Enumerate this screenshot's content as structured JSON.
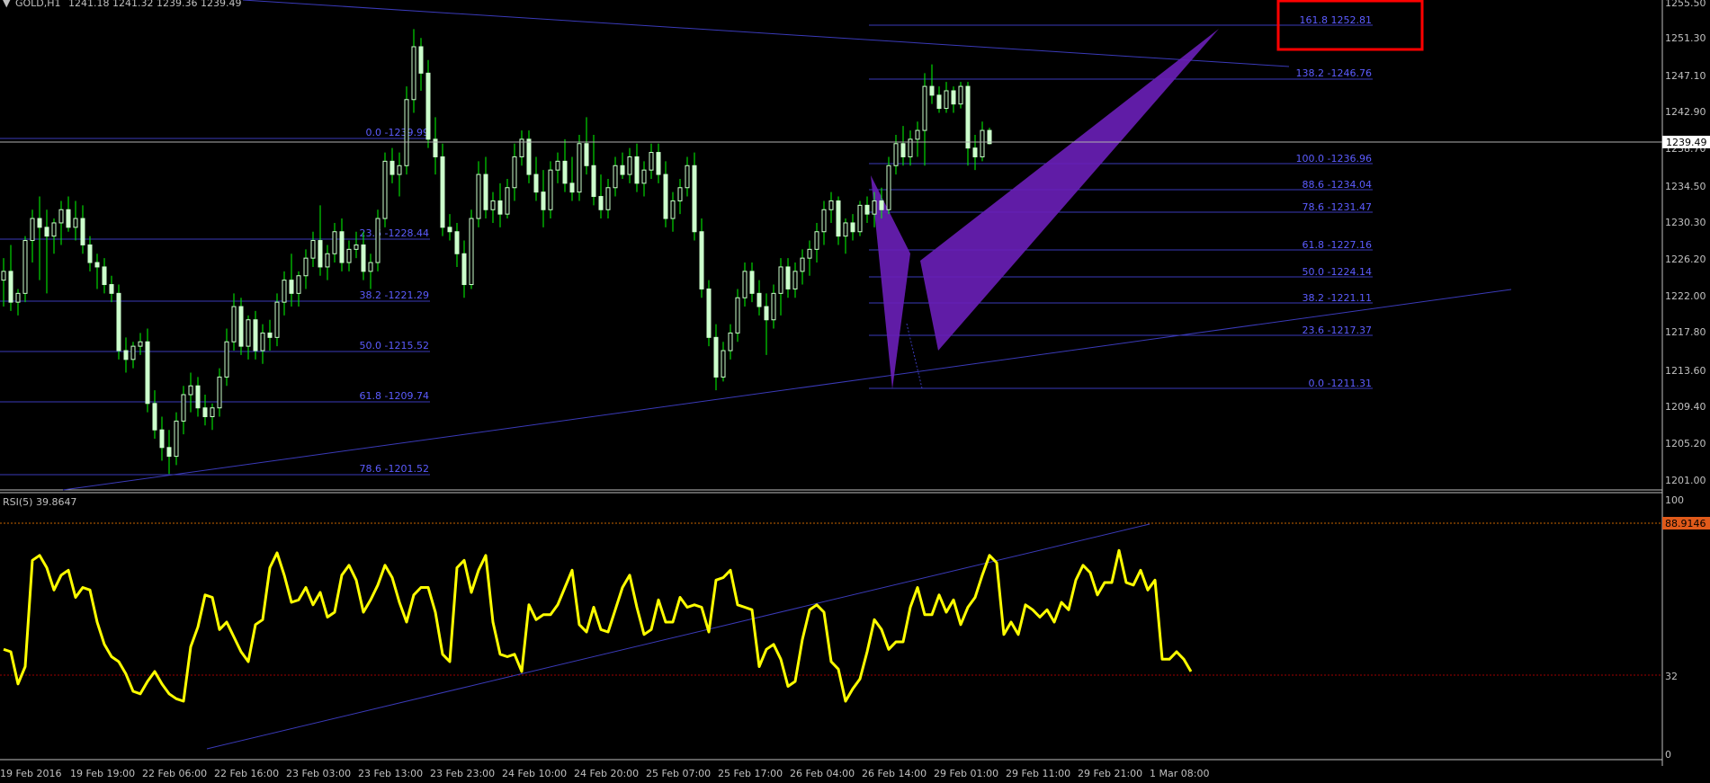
{
  "header": {
    "collapse_glyph": "▼",
    "symbol_label": "GOLD,H1",
    "ohlc_text": "1241.18 1241.32 1239.36 1239.49"
  },
  "price_axis": {
    "labels": [
      "1255.50",
      "1251.30",
      "1247.10",
      "1242.90",
      "1238.70",
      "1234.50",
      "1230.30",
      "1226.20",
      "1222.00",
      "1217.80",
      "1213.60",
      "1209.40",
      "1205.20",
      "1201.00"
    ],
    "current_price": "1239.49"
  },
  "rsi": {
    "label": "RSI(5) 39.8647",
    "axis_labels": [
      "100",
      "32",
      "0"
    ],
    "badge_value": "88.9146"
  },
  "time_axis": {
    "labels": [
      "19 Feb 2016",
      "19 Feb 19:00",
      "22 Feb 06:00",
      "22 Feb 16:00",
      "23 Feb 03:00",
      "23 Feb 13:00",
      "23 Feb 23:00",
      "24 Feb 10:00",
      "24 Feb 20:00",
      "25 Feb 07:00",
      "25 Feb 17:00",
      "26 Feb 04:00",
      "26 Feb 14:00",
      "29 Feb 01:00",
      "29 Feb 11:00",
      "29 Feb 21:00",
      "1 Mar 08:00"
    ]
  },
  "fib_left": {
    "labels": [
      "0.0 -1239.99",
      "23.6 -1228.44",
      "38.2 -1221.29",
      "50.0 -1215.52",
      "61.8 -1209.74",
      "78.6 -1201.52"
    ]
  },
  "fib_right": {
    "labels": [
      "161.8 1252.81",
      "138.2  -1246.76",
      "100.0 -1236.96",
      "88.6 -1234.04",
      "78.6 -1231.47",
      "61.8 -1227.16",
      "50.0 -1224.14",
      "38.2 -1221.11",
      "23.6 -1217.37",
      "0.0 -1211.31"
    ]
  },
  "colors": {
    "background": "#000000",
    "candle": "#ccffcc",
    "wick": "#00ff00",
    "fib_line": "#3a3ab8",
    "fib_text": "#5c5cff",
    "pattern_fill": "#6a1fb8",
    "rsi_line": "#ffff00",
    "highlight_box": "#ff0000",
    "level_red": "#c86400",
    "axis_text": "#c0c0c0"
  },
  "chart_data": {
    "type": "candlestick",
    "symbol": "GOLD",
    "timeframe": "H1",
    "price_range": [
      1201.0,
      1255.5
    ],
    "candles": [
      {
        "o": 1224.0,
        "h": 1226.5,
        "l": 1221.0,
        "c": 1225.0
      },
      {
        "o": 1225.0,
        "h": 1228.0,
        "l": 1220.5,
        "c": 1221.5
      },
      {
        "o": 1221.5,
        "h": 1223.0,
        "l": 1220.0,
        "c": 1222.5
      },
      {
        "o": 1222.5,
        "h": 1229.0,
        "l": 1221.5,
        "c": 1228.5
      },
      {
        "o": 1228.5,
        "h": 1232.0,
        "l": 1226.0,
        "c": 1231.0
      },
      {
        "o": 1231.0,
        "h": 1233.5,
        "l": 1224.0,
        "c": 1230.0
      },
      {
        "o": 1230.0,
        "h": 1232.0,
        "l": 1222.5,
        "c": 1229.0
      },
      {
        "o": 1229.0,
        "h": 1231.0,
        "l": 1227.0,
        "c": 1230.5
      },
      {
        "o": 1230.5,
        "h": 1233.0,
        "l": 1228.0,
        "c": 1232.0
      },
      {
        "o": 1232.0,
        "h": 1233.5,
        "l": 1229.5,
        "c": 1230.0
      },
      {
        "o": 1230.0,
        "h": 1233.0,
        "l": 1228.5,
        "c": 1231.0
      },
      {
        "o": 1231.0,
        "h": 1232.5,
        "l": 1227.0,
        "c": 1228.0
      },
      {
        "o": 1228.0,
        "h": 1229.0,
        "l": 1225.0,
        "c": 1226.0
      },
      {
        "o": 1226.0,
        "h": 1227.0,
        "l": 1223.0,
        "c": 1225.5
      },
      {
        "o": 1225.5,
        "h": 1226.5,
        "l": 1222.5,
        "c": 1223.5
      },
      {
        "o": 1223.5,
        "h": 1224.5,
        "l": 1221.5,
        "c": 1222.5
      },
      {
        "o": 1222.5,
        "h": 1223.5,
        "l": 1215.0,
        "c": 1216.0
      },
      {
        "o": 1216.0,
        "h": 1217.5,
        "l": 1213.5,
        "c": 1215.0
      },
      {
        "o": 1215.0,
        "h": 1217.0,
        "l": 1214.0,
        "c": 1216.5
      },
      {
        "o": 1216.5,
        "h": 1218.0,
        "l": 1215.5,
        "c": 1217.0
      },
      {
        "o": 1217.0,
        "h": 1218.5,
        "l": 1209.0,
        "c": 1210.0
      },
      {
        "o": 1210.0,
        "h": 1211.5,
        "l": 1206.0,
        "c": 1207.0
      },
      {
        "o": 1207.0,
        "h": 1208.5,
        "l": 1203.5,
        "c": 1205.0
      },
      {
        "o": 1205.0,
        "h": 1207.0,
        "l": 1202.0,
        "c": 1204.0
      },
      {
        "o": 1204.0,
        "h": 1209.0,
        "l": 1203.0,
        "c": 1208.0
      },
      {
        "o": 1208.0,
        "h": 1212.0,
        "l": 1206.5,
        "c": 1211.0
      },
      {
        "o": 1211.0,
        "h": 1213.5,
        "l": 1209.0,
        "c": 1212.0
      },
      {
        "o": 1212.0,
        "h": 1213.0,
        "l": 1208.5,
        "c": 1209.5
      },
      {
        "o": 1209.5,
        "h": 1211.0,
        "l": 1207.5,
        "c": 1208.5
      },
      {
        "o": 1208.5,
        "h": 1210.0,
        "l": 1207.0,
        "c": 1209.5
      },
      {
        "o": 1209.5,
        "h": 1214.0,
        "l": 1208.5,
        "c": 1213.0
      },
      {
        "o": 1213.0,
        "h": 1218.5,
        "l": 1212.0,
        "c": 1217.0
      },
      {
        "o": 1217.0,
        "h": 1222.5,
        "l": 1216.0,
        "c": 1221.0
      },
      {
        "o": 1221.0,
        "h": 1222.0,
        "l": 1215.5,
        "c": 1216.5
      },
      {
        "o": 1216.5,
        "h": 1220.0,
        "l": 1215.0,
        "c": 1219.5
      },
      {
        "o": 1219.5,
        "h": 1220.5,
        "l": 1215.0,
        "c": 1216.0
      },
      {
        "o": 1216.0,
        "h": 1219.0,
        "l": 1214.5,
        "c": 1218.0
      },
      {
        "o": 1218.0,
        "h": 1219.5,
        "l": 1216.0,
        "c": 1217.5
      },
      {
        "o": 1217.5,
        "h": 1222.5,
        "l": 1216.5,
        "c": 1221.5
      },
      {
        "o": 1221.5,
        "h": 1225.0,
        "l": 1220.0,
        "c": 1224.0
      },
      {
        "o": 1224.0,
        "h": 1227.0,
        "l": 1221.0,
        "c": 1222.5
      },
      {
        "o": 1222.5,
        "h": 1225.0,
        "l": 1221.0,
        "c": 1224.5
      },
      {
        "o": 1224.5,
        "h": 1227.5,
        "l": 1223.0,
        "c": 1226.5
      },
      {
        "o": 1226.5,
        "h": 1229.5,
        "l": 1225.5,
        "c": 1228.5
      },
      {
        "o": 1228.5,
        "h": 1232.5,
        "l": 1224.5,
        "c": 1225.5
      },
      {
        "o": 1225.5,
        "h": 1228.0,
        "l": 1224.0,
        "c": 1227.0
      },
      {
        "o": 1227.0,
        "h": 1230.5,
        "l": 1226.0,
        "c": 1229.5
      },
      {
        "o": 1229.5,
        "h": 1231.0,
        "l": 1225.0,
        "c": 1226.0
      },
      {
        "o": 1226.0,
        "h": 1228.5,
        "l": 1225.0,
        "c": 1227.5
      },
      {
        "o": 1227.5,
        "h": 1229.5,
        "l": 1226.5,
        "c": 1228.0
      },
      {
        "o": 1228.0,
        "h": 1229.5,
        "l": 1224.0,
        "c": 1225.0
      },
      {
        "o": 1225.0,
        "h": 1227.0,
        "l": 1223.0,
        "c": 1226.0
      },
      {
        "o": 1226.0,
        "h": 1232.0,
        "l": 1225.0,
        "c": 1231.0
      },
      {
        "o": 1231.0,
        "h": 1238.5,
        "l": 1230.0,
        "c": 1237.5
      },
      {
        "o": 1237.5,
        "h": 1239.0,
        "l": 1235.0,
        "c": 1236.0
      },
      {
        "o": 1236.0,
        "h": 1238.5,
        "l": 1233.5,
        "c": 1237.0
      },
      {
        "o": 1237.0,
        "h": 1246.0,
        "l": 1236.0,
        "c": 1244.5
      },
      {
        "o": 1244.5,
        "h": 1252.5,
        "l": 1243.0,
        "c": 1250.5
      },
      {
        "o": 1250.5,
        "h": 1251.5,
        "l": 1245.5,
        "c": 1247.5
      },
      {
        "o": 1247.5,
        "h": 1249.0,
        "l": 1239.0,
        "c": 1240.0
      },
      {
        "o": 1240.0,
        "h": 1242.5,
        "l": 1236.0,
        "c": 1238.0
      },
      {
        "o": 1238.0,
        "h": 1239.5,
        "l": 1229.0,
        "c": 1230.0
      },
      {
        "o": 1230.0,
        "h": 1231.5,
        "l": 1228.5,
        "c": 1229.5
      },
      {
        "o": 1229.5,
        "h": 1230.5,
        "l": 1225.5,
        "c": 1227.0
      },
      {
        "o": 1227.0,
        "h": 1228.5,
        "l": 1222.0,
        "c": 1223.5
      },
      {
        "o": 1223.5,
        "h": 1232.0,
        "l": 1223.0,
        "c": 1231.0
      },
      {
        "o": 1231.0,
        "h": 1237.5,
        "l": 1230.0,
        "c": 1236.0
      },
      {
        "o": 1236.0,
        "h": 1238.0,
        "l": 1231.0,
        "c": 1232.0
      },
      {
        "o": 1232.0,
        "h": 1234.0,
        "l": 1230.5,
        "c": 1233.0
      },
      {
        "o": 1233.0,
        "h": 1235.0,
        "l": 1230.0,
        "c": 1231.5
      },
      {
        "o": 1231.5,
        "h": 1235.5,
        "l": 1231.0,
        "c": 1234.5
      },
      {
        "o": 1234.5,
        "h": 1239.5,
        "l": 1233.0,
        "c": 1238.0
      },
      {
        "o": 1238.0,
        "h": 1241.0,
        "l": 1237.0,
        "c": 1240.0
      },
      {
        "o": 1240.0,
        "h": 1241.0,
        "l": 1235.0,
        "c": 1236.0
      },
      {
        "o": 1236.0,
        "h": 1238.0,
        "l": 1233.0,
        "c": 1234.0
      },
      {
        "o": 1234.0,
        "h": 1236.5,
        "l": 1230.0,
        "c": 1232.0
      },
      {
        "o": 1232.0,
        "h": 1237.5,
        "l": 1231.0,
        "c": 1236.5
      },
      {
        "o": 1236.5,
        "h": 1238.5,
        "l": 1235.0,
        "c": 1237.5
      },
      {
        "o": 1237.5,
        "h": 1240.0,
        "l": 1234.0,
        "c": 1235.0
      },
      {
        "o": 1235.0,
        "h": 1238.0,
        "l": 1233.0,
        "c": 1234.0
      },
      {
        "o": 1234.0,
        "h": 1240.5,
        "l": 1233.0,
        "c": 1239.5
      },
      {
        "o": 1239.5,
        "h": 1242.5,
        "l": 1236.0,
        "c": 1237.0
      },
      {
        "o": 1237.0,
        "h": 1240.5,
        "l": 1232.5,
        "c": 1233.5
      },
      {
        "o": 1233.5,
        "h": 1236.0,
        "l": 1231.0,
        "c": 1232.0
      },
      {
        "o": 1232.0,
        "h": 1235.5,
        "l": 1231.0,
        "c": 1234.5
      },
      {
        "o": 1234.5,
        "h": 1238.0,
        "l": 1233.5,
        "c": 1237.0
      },
      {
        "o": 1237.0,
        "h": 1238.5,
        "l": 1235.5,
        "c": 1236.0
      },
      {
        "o": 1236.0,
        "h": 1239.0,
        "l": 1235.0,
        "c": 1238.0
      },
      {
        "o": 1238.0,
        "h": 1239.5,
        "l": 1234.0,
        "c": 1235.0
      },
      {
        "o": 1235.0,
        "h": 1237.5,
        "l": 1233.5,
        "c": 1236.5
      },
      {
        "o": 1236.5,
        "h": 1239.5,
        "l": 1235.5,
        "c": 1238.5
      },
      {
        "o": 1238.5,
        "h": 1239.5,
        "l": 1235.0,
        "c": 1236.0
      },
      {
        "o": 1236.0,
        "h": 1237.5,
        "l": 1230.0,
        "c": 1231.0
      },
      {
        "o": 1231.0,
        "h": 1234.0,
        "l": 1229.5,
        "c": 1233.0
      },
      {
        "o": 1233.0,
        "h": 1235.5,
        "l": 1231.5,
        "c": 1234.5
      },
      {
        "o": 1234.5,
        "h": 1238.0,
        "l": 1233.5,
        "c": 1237.0
      },
      {
        "o": 1237.0,
        "h": 1238.5,
        "l": 1228.5,
        "c": 1229.5
      },
      {
        "o": 1229.5,
        "h": 1231.0,
        "l": 1222.0,
        "c": 1223.0
      },
      {
        "o": 1223.0,
        "h": 1224.0,
        "l": 1216.5,
        "c": 1217.5
      },
      {
        "o": 1217.5,
        "h": 1219.0,
        "l": 1211.5,
        "c": 1213.0
      },
      {
        "o": 1213.0,
        "h": 1217.0,
        "l": 1212.5,
        "c": 1216.0
      },
      {
        "o": 1216.0,
        "h": 1219.0,
        "l": 1215.0,
        "c": 1218.0
      },
      {
        "o": 1218.0,
        "h": 1223.0,
        "l": 1217.0,
        "c": 1222.0
      },
      {
        "o": 1222.0,
        "h": 1226.0,
        "l": 1221.0,
        "c": 1225.0
      },
      {
        "o": 1225.0,
        "h": 1226.0,
        "l": 1221.5,
        "c": 1222.5
      },
      {
        "o": 1222.5,
        "h": 1224.0,
        "l": 1220.0,
        "c": 1221.0
      },
      {
        "o": 1221.0,
        "h": 1222.5,
        "l": 1215.5,
        "c": 1219.5
      },
      {
        "o": 1219.5,
        "h": 1223.5,
        "l": 1218.5,
        "c": 1222.5
      },
      {
        "o": 1222.5,
        "h": 1226.5,
        "l": 1220.0,
        "c": 1225.5
      },
      {
        "o": 1225.5,
        "h": 1226.5,
        "l": 1222.0,
        "c": 1223.0
      },
      {
        "o": 1223.0,
        "h": 1226.0,
        "l": 1222.0,
        "c": 1225.0
      },
      {
        "o": 1225.0,
        "h": 1227.5,
        "l": 1223.5,
        "c": 1226.5
      },
      {
        "o": 1226.5,
        "h": 1228.5,
        "l": 1224.5,
        "c": 1227.5
      },
      {
        "o": 1227.5,
        "h": 1230.5,
        "l": 1226.0,
        "c": 1229.5
      },
      {
        "o": 1229.5,
        "h": 1233.0,
        "l": 1228.0,
        "c": 1232.0
      },
      {
        "o": 1232.0,
        "h": 1234.0,
        "l": 1230.5,
        "c": 1233.0
      },
      {
        "o": 1233.0,
        "h": 1233.5,
        "l": 1228.0,
        "c": 1229.0
      },
      {
        "o": 1229.0,
        "h": 1231.0,
        "l": 1227.0,
        "c": 1230.5
      },
      {
        "o": 1230.5,
        "h": 1231.5,
        "l": 1228.5,
        "c": 1229.5
      },
      {
        "o": 1229.5,
        "h": 1233.0,
        "l": 1229.0,
        "c": 1232.5
      },
      {
        "o": 1232.5,
        "h": 1233.5,
        "l": 1230.5,
        "c": 1231.5
      },
      {
        "o": 1231.5,
        "h": 1234.0,
        "l": 1230.0,
        "c": 1233.0
      },
      {
        "o": 1233.0,
        "h": 1234.5,
        "l": 1231.0,
        "c": 1232.0
      },
      {
        "o": 1232.0,
        "h": 1238.0,
        "l": 1231.5,
        "c": 1237.0
      },
      {
        "o": 1237.0,
        "h": 1240.5,
        "l": 1236.0,
        "c": 1239.5
      },
      {
        "o": 1239.5,
        "h": 1241.5,
        "l": 1237.0,
        "c": 1238.0
      },
      {
        "o": 1238.0,
        "h": 1241.0,
        "l": 1237.0,
        "c": 1240.0
      },
      {
        "o": 1240.0,
        "h": 1242.0,
        "l": 1238.0,
        "c": 1241.0
      },
      {
        "o": 1241.0,
        "h": 1247.5,
        "l": 1237.0,
        "c": 1246.0
      },
      {
        "o": 1246.0,
        "h": 1248.5,
        "l": 1244.0,
        "c": 1245.0
      },
      {
        "o": 1245.0,
        "h": 1246.0,
        "l": 1243.0,
        "c": 1243.5
      },
      {
        "o": 1243.5,
        "h": 1246.5,
        "l": 1243.0,
        "c": 1245.5
      },
      {
        "o": 1245.5,
        "h": 1246.0,
        "l": 1243.0,
        "c": 1244.0
      },
      {
        "o": 1244.0,
        "h": 1246.5,
        "l": 1243.5,
        "c": 1246.0
      },
      {
        "o": 1246.0,
        "h": 1246.5,
        "l": 1237.0,
        "c": 1239.0
      },
      {
        "o": 1239.0,
        "h": 1240.5,
        "l": 1236.5,
        "c": 1238.0
      },
      {
        "o": 1238.0,
        "h": 1242.0,
        "l": 1237.5,
        "c": 1241.0
      },
      {
        "o": 1241.0,
        "h": 1241.3,
        "l": 1239.4,
        "c": 1239.5
      }
    ],
    "rsi": [
      41,
      40,
      27,
      34,
      77,
      79,
      74,
      65,
      71,
      73,
      62,
      66,
      65,
      52,
      43,
      38,
      36,
      31,
      24,
      23,
      28,
      32,
      27,
      23,
      21,
      20,
      42,
      50,
      63,
      62,
      49,
      52,
      46,
      40,
      36,
      51,
      53,
      74,
      80,
      71,
      60,
      61,
      66,
      59,
      64,
      54,
      56,
      71,
      75,
      69,
      56,
      61,
      67,
      75,
      70,
      60,
      52,
      63,
      66,
      66,
      56,
      39,
      36,
      74,
      77,
      64,
      73,
      79,
      52,
      39,
      38,
      39,
      32,
      59,
      53,
      55,
      55,
      59,
      66,
      73,
      51,
      48,
      58,
      49,
      48,
      57,
      66,
      71,
      58,
      47,
      49,
      61,
      52,
      52,
      62,
      58,
      59,
      58,
      48,
      69,
      70,
      73,
      59,
      58,
      57,
      34,
      41,
      43,
      37,
      26,
      28,
      45,
      57,
      59,
      56,
      36,
      33,
      20,
      25,
      29,
      40,
      53,
      49,
      41,
      44,
      44,
      58,
      66,
      55,
      55,
      63,
      56,
      61,
      51,
      58,
      62,
      71,
      79,
      76,
      47,
      52,
      47,
      59,
      57,
      54,
      57,
      52,
      60,
      57,
      69,
      75,
      72,
      63,
      68,
      68,
      81,
      68,
      67,
      73,
      65,
      69,
      37,
      37,
      40,
      37,
      32
    ],
    "rsi_levels": [
      32,
      88.9146
    ],
    "rsi_value": 39.8647
  }
}
